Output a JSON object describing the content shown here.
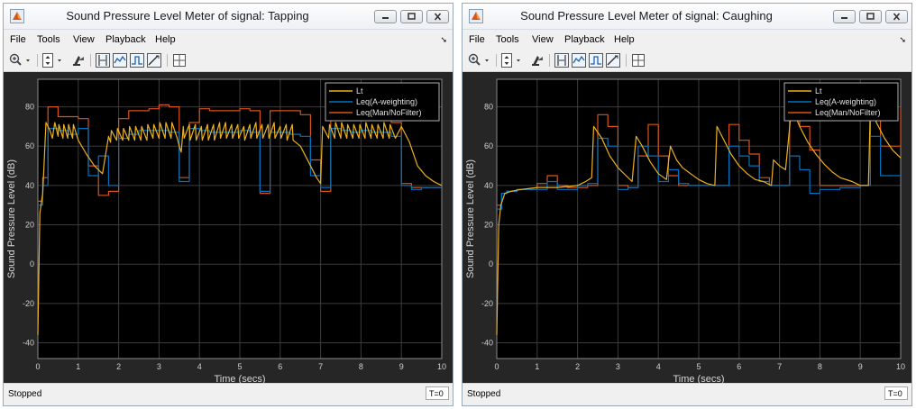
{
  "menus": [
    "File",
    "Tools",
    "View",
    "Playback",
    "Help"
  ],
  "toolbar_icons": [
    "zoom-in-icon",
    "scale-axes-icon",
    "simulink-icon",
    "cursor-measurement-icon",
    "signal-statistics-icon",
    "bilevel-measurement-icon",
    "peak-finder-icon",
    "layout-icon"
  ],
  "windows": [
    {
      "title": "Sound Pressure Level Meter of signal: Tapping",
      "status": "Stopped",
      "time_indicator": "T=0",
      "chart_data": {
        "type": "line",
        "xlabel": "Time (secs)",
        "ylabel": "Sound Pressure Level (dB)",
        "xlim": [
          0,
          10
        ],
        "ylim": [
          -48,
          94
        ],
        "xticks": [
          "0",
          "1",
          "2",
          "3",
          "4",
          "5",
          "6",
          "7",
          "8",
          "9",
          "10"
        ],
        "yticks": [
          "-40",
          "-20",
          "0",
          "20",
          "40",
          "60",
          "80"
        ],
        "grid": true,
        "legend_position": "top-right",
        "series": [
          {
            "name": "Lt",
            "color": "#edb120",
            "step": false,
            "x": [
              0,
              0.05,
              0.12,
              0.2,
              0.3,
              0.36,
              0.42,
              0.5,
              0.52,
              0.62,
              0.64,
              0.74,
              0.76,
              0.86,
              0.88,
              1.0,
              1.2,
              1.4,
              1.6,
              1.75,
              1.8,
              1.82,
              1.95,
              1.97,
              2.1,
              2.12,
              2.25,
              2.27,
              2.4,
              2.42,
              2.55,
              2.57,
              2.7,
              2.72,
              2.85,
              2.87,
              3.0,
              3.02,
              3.15,
              3.17,
              3.3,
              3.32,
              3.45,
              3.5,
              3.55,
              3.6,
              3.62,
              3.75,
              3.77,
              3.9,
              3.92,
              4.05,
              4.07,
              4.2,
              4.22,
              4.35,
              4.37,
              4.5,
              4.52,
              4.65,
              4.67,
              4.8,
              4.82,
              4.95,
              4.97,
              5.1,
              5.12,
              5.25,
              5.27,
              5.4,
              5.42,
              5.55,
              5.57,
              5.7,
              5.72,
              5.85,
              5.87,
              6.0,
              6.02,
              6.15,
              6.17,
              6.3,
              6.32,
              6.5,
              6.7,
              6.9,
              7.0,
              7.05,
              7.2,
              7.22,
              7.35,
              7.37,
              7.5,
              7.52,
              7.65,
              7.67,
              7.8,
              7.82,
              7.95,
              7.97,
              8.1,
              8.12,
              8.25,
              8.27,
              8.4,
              8.42,
              8.55,
              8.57,
              8.7,
              8.72,
              8.85,
              9.0,
              9.2,
              9.4,
              9.6,
              9.8,
              10.0
            ],
            "y": [
              -36,
              26,
              36,
              72,
              68,
              64,
              72,
              65,
              71,
              64,
              71,
              64,
              71,
              64,
              71,
              63,
              56,
              50,
              46,
              65,
              62,
              68,
              63,
              69,
              63,
              69,
              63,
              70,
              63,
              70,
              63,
              70,
              63,
              71,
              64,
              71,
              64,
              72,
              64,
              72,
              64,
              72,
              64,
              60,
              57,
              70,
              64,
              71,
              63,
              71,
              63,
              70,
              63,
              71,
              63,
              71,
              63,
              72,
              64,
              72,
              64,
              71,
              64,
              71,
              64,
              70,
              63,
              71,
              64,
              72,
              64,
              71,
              64,
              71,
              64,
              72,
              64,
              70,
              64,
              71,
              63,
              71,
              63,
              60,
              52,
              44,
              41,
              70,
              64,
              71,
              64,
              72,
              64,
              72,
              64,
              71,
              64,
              71,
              64,
              71,
              64,
              72,
              64,
              71,
              64,
              71,
              64,
              72,
              64,
              71,
              64,
              70,
              62,
              50,
              45,
              42,
              40,
              40
            ]
          },
          {
            "name": "Leq(A-weighting)",
            "color": "#0072bd",
            "step": true,
            "x": [
              0,
              0.12,
              0.25,
              0.5,
              0.75,
              1.0,
              1.25,
              1.5,
              1.75,
              2.0,
              2.25,
              2.5,
              2.75,
              3.0,
              3.25,
              3.5,
              3.75,
              4.0,
              4.25,
              4.5,
              4.75,
              5.0,
              5.25,
              5.5,
              5.75,
              6.0,
              6.25,
              6.5,
              6.75,
              7.0,
              7.25,
              7.5,
              7.75,
              8.0,
              8.25,
              8.5,
              8.75,
              9.0,
              9.25,
              9.5,
              10.0
            ],
            "y": [
              30,
              40,
              69,
              68,
              66,
              69,
              45,
              55,
              40,
              64,
              66,
              68,
              68,
              68,
              67,
              42,
              69,
              68,
              67,
              67,
              67,
              68,
              67,
              37,
              67,
              67,
              66,
              65,
              45,
              39,
              69,
              68,
              67,
              68,
              67,
              67,
              65,
              40,
              38,
              39,
              39
            ]
          },
          {
            "name": "Leq(Man/NoFilter)",
            "color": "#d95319",
            "step": true,
            "x": [
              0,
              0.12,
              0.25,
              0.5,
              0.75,
              1.0,
              1.25,
              1.5,
              1.75,
              2.0,
              2.25,
              2.5,
              2.75,
              3.0,
              3.25,
              3.5,
              3.75,
              4.0,
              4.25,
              4.5,
              4.75,
              5.0,
              5.25,
              5.5,
              5.75,
              6.0,
              6.25,
              6.5,
              6.75,
              7.0,
              7.25,
              7.5,
              7.75,
              8.0,
              8.25,
              8.5,
              8.75,
              9.0,
              9.25,
              9.5,
              10.0
            ],
            "y": [
              32,
              44,
              80,
              75,
              75,
              74,
              50,
              35,
              37,
              74,
              78,
              78,
              79,
              81,
              80,
              44,
              72,
              79,
              78,
              78,
              78,
              79,
              78,
              36,
              78,
              78,
              78,
              76,
              53,
              37,
              75,
              76,
              76,
              76,
              76,
              76,
              72,
              41,
              39,
              39,
              39
            ]
          }
        ]
      }
    },
    {
      "title": "Sound Pressure Level Meter of signal: Caughing",
      "status": "Stopped",
      "time_indicator": "T=0",
      "chart_data": {
        "type": "line",
        "xlabel": "Time (secs)",
        "ylabel": "Sound Pressure Level (dB)",
        "xlim": [
          0,
          10
        ],
        "ylim": [
          -48,
          94
        ],
        "xticks": [
          "0",
          "1",
          "2",
          "3",
          "4",
          "5",
          "6",
          "7",
          "8",
          "9",
          "10"
        ],
        "yticks": [
          "-40",
          "-20",
          "0",
          "20",
          "40",
          "60",
          "80"
        ],
        "grid": true,
        "legend_position": "top-right",
        "series": [
          {
            "name": "Lt",
            "color": "#edb120",
            "step": false,
            "x": [
              0,
              0.05,
              0.1,
              0.2,
              0.35,
              0.6,
              1.0,
              1.5,
              2.0,
              2.2,
              2.35,
              2.4,
              2.6,
              2.8,
              3.0,
              3.2,
              3.35,
              3.45,
              3.6,
              3.8,
              4.0,
              4.2,
              4.3,
              4.45,
              4.6,
              4.8,
              5.0,
              5.2,
              5.4,
              5.45,
              5.6,
              5.8,
              6.0,
              6.2,
              6.4,
              6.6,
              6.8,
              6.85,
              7.0,
              7.15,
              7.3,
              7.5,
              7.7,
              7.9,
              8.1,
              8.3,
              8.5,
              8.8,
              9.0,
              9.2,
              9.25,
              9.4,
              9.6,
              9.8,
              10.0
            ],
            "y": [
              -36,
              20,
              30,
              36,
              37,
              38,
              39,
              39,
              40,
              42,
              44,
              70,
              64,
              55,
              49,
              45,
              42,
              65,
              60,
              52,
              46,
              43,
              60,
              53,
              49,
              46,
              43,
              41,
              40,
              70,
              64,
              56,
              50,
              46,
              43,
              42,
              40,
              53,
              50,
              48,
              80,
              70,
              62,
              56,
              51,
              47,
              44,
              42,
              40,
              40,
              80,
              72,
              64,
              58,
              54
            ]
          },
          {
            "name": "Leq(A-weighting)",
            "color": "#0072bd",
            "step": true,
            "x": [
              0,
              0.12,
              0.25,
              0.5,
              0.75,
              1.0,
              1.25,
              1.5,
              1.75,
              2.0,
              2.25,
              2.5,
              2.75,
              3.0,
              3.25,
              3.5,
              3.75,
              4.0,
              4.25,
              4.5,
              4.75,
              5.0,
              5.25,
              5.5,
              5.75,
              6.0,
              6.25,
              6.5,
              6.75,
              7.0,
              7.25,
              7.5,
              7.75,
              8.0,
              8.25,
              8.5,
              8.75,
              9.0,
              9.25,
              9.5,
              10.0
            ],
            "y": [
              28,
              36,
              37,
              38,
              38,
              38,
              42,
              38,
              38,
              40,
              41,
              64,
              60,
              38,
              39,
              60,
              55,
              42,
              48,
              41,
              40,
              40,
              40,
              40,
              60,
              55,
              50,
              42,
              40,
              40,
              55,
              48,
              36,
              38,
              38,
              39,
              39,
              40,
              65,
              45,
              45
            ]
          },
          {
            "name": "Leq(Man/NoFilter)",
            "color": "#d95319",
            "step": true,
            "x": [
              0,
              0.12,
              0.25,
              0.5,
              0.75,
              1.0,
              1.25,
              1.5,
              1.75,
              2.0,
              2.25,
              2.5,
              2.75,
              3.0,
              3.25,
              3.5,
              3.75,
              4.0,
              4.25,
              4.5,
              4.75,
              5.0,
              5.25,
              5.5,
              5.75,
              6.0,
              6.25,
              6.5,
              6.75,
              7.0,
              7.25,
              7.5,
              7.75,
              8.0,
              8.25,
              8.5,
              8.75,
              9.0,
              9.25,
              9.5,
              10.0
            ],
            "y": [
              30,
              36,
              37,
              38,
              38,
              41,
              45,
              40,
              39,
              39,
              40,
              76,
              70,
              40,
              39,
              55,
              71,
              55,
              45,
              40,
              40,
              40,
              40,
              40,
              71,
              63,
              56,
              44,
              40,
              40,
              80,
              70,
              58,
              40,
              40,
              40,
              40,
              40,
              85,
              60,
              80
            ]
          }
        ]
      }
    }
  ]
}
